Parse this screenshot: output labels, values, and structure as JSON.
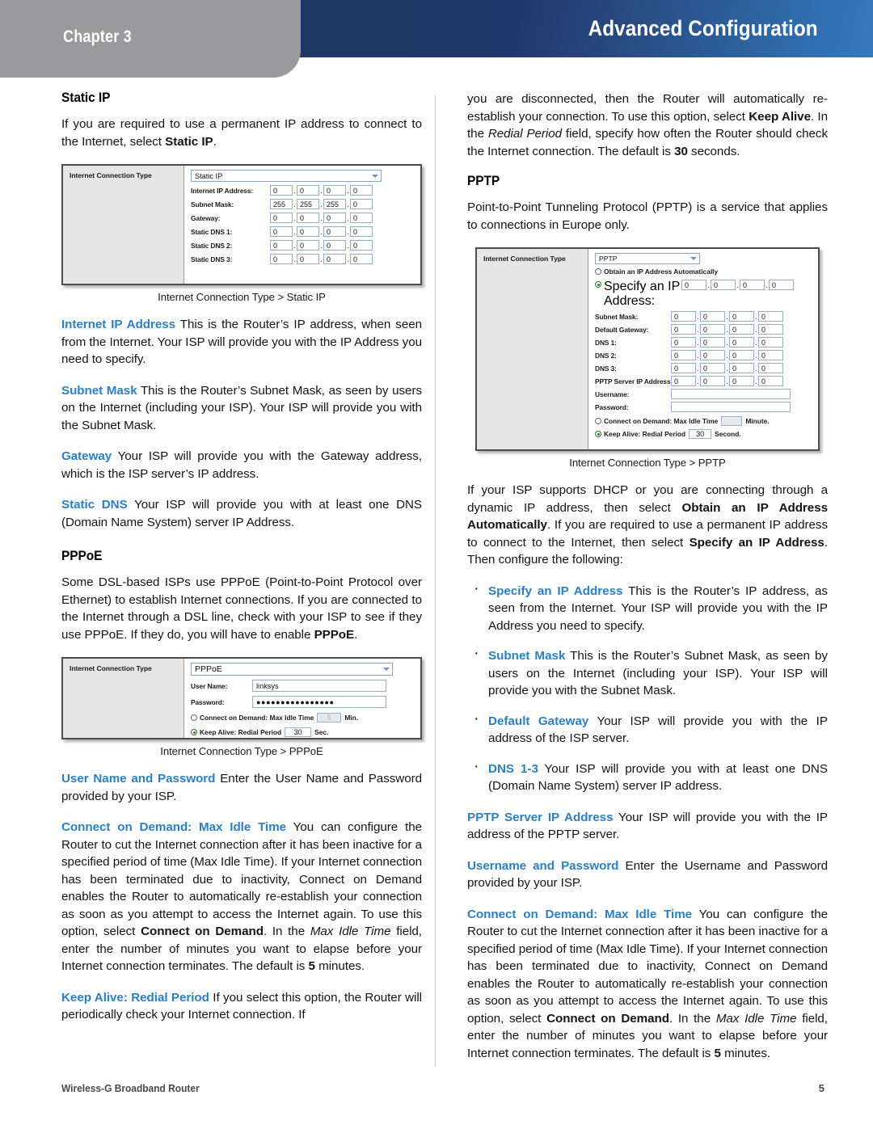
{
  "header": {
    "chapter": "Chapter 3",
    "title": "Advanced Configuration"
  },
  "footer": {
    "product": "Wireless-G Broadband Router",
    "page_number": "5"
  },
  "left_column": {
    "static_ip_heading": "Static IP",
    "static_ip_intro_a": "If you are required to use a permanent IP address to connect to the Internet, select ",
    "static_ip_intro_b": "Static IP",
    "static_ip_intro_c": ".",
    "figure_static_ip": {
      "panel_label": "Internet Connection Type",
      "select_value": "Static IP",
      "caption": "Internet Connection Type > Static IP",
      "rows": [
        {
          "label": "Internet IP Address:",
          "octets": [
            "0",
            "0",
            "0",
            "0"
          ]
        },
        {
          "label": "Subnet Mask:",
          "octets": [
            "255",
            "255",
            "255",
            "0"
          ]
        },
        {
          "label": "Gateway:",
          "octets": [
            "0",
            "0",
            "0",
            "0"
          ]
        },
        {
          "label": "Static DNS 1:",
          "octets": [
            "0",
            "0",
            "0",
            "0"
          ]
        },
        {
          "label": "Static DNS 2:",
          "octets": [
            "0",
            "0",
            "0",
            "0"
          ]
        },
        {
          "label": "Static DNS 3:",
          "octets": [
            "0",
            "0",
            "0",
            "0"
          ]
        }
      ]
    },
    "para_internet_ip_term": "Internet IP Address",
    "para_internet_ip_text": "  This is the Router’s IP address, when seen from the Internet. Your ISP will provide you with the IP Address you need to specify.",
    "para_subnet_term": "Subnet Mask",
    "para_subnet_text": "  This is the Router’s Subnet Mask, as seen by users on the Internet (including your ISP). Your ISP will provide you with the Subnet Mask.",
    "para_gateway_term": "Gateway",
    "para_gateway_text": "  Your ISP will provide you with the Gateway address, which is the ISP server’s IP address.",
    "para_staticdns_term": "Static DNS",
    "para_staticdns_text": "  Your ISP will provide you with at least one DNS (Domain Name System) server IP Address.",
    "pppoe_heading": "PPPoE",
    "pppoe_intro_a": "Some DSL-based ISPs use PPPoE (Point-to-Point Protocol over Ethernet) to establish Internet connections. If you are connected to the Internet through a DSL line, check with your ISP to see if they use PPPoE. If they do, you will have to enable ",
    "pppoe_intro_b": "PPPoE",
    "pppoe_intro_c": ".",
    "figure_pppoe": {
      "panel_label": "Internet Connection Type",
      "select_value": "PPPoE",
      "caption": "Internet Connection Type > PPPoE",
      "user_name_label": "User Name:",
      "user_name_value": "linksys",
      "password_label": "Password:",
      "password_value": "●●●●●●●●●●●●●●●●",
      "connect_on_demand_label": "Connect on Demand: Max Idle Time",
      "connect_on_demand_value": "5",
      "connect_on_demand_unit": "Min.",
      "keep_alive_label": "Keep Alive: Redial Period",
      "keep_alive_value": "30",
      "keep_alive_unit": "Sec."
    },
    "para_username_term": "User Name and Password",
    "para_username_text": " Enter the User Name and Password provided by your ISP.",
    "para_cod_term": "Connect on Demand: Max Idle Time",
    "para_cod_text_1": "  You can configure the Router to cut the Internet connection after it has been inactive for a specified period of time (Max Idle Time). If your Internet connection has been terminated due to inactivity, Connect on Demand enables the Router to automatically re-establish your connection as soon as you attempt to access the Internet again. To use this option, select ",
    "para_cod_bold_1": "Connect on Demand",
    "para_cod_text_2": ". In the ",
    "para_cod_italic": "Max Idle Time",
    "para_cod_text_3": " field, enter the number of minutes you want to elapse before your Internet connection terminates. The default is ",
    "para_cod_bold_2": "5",
    "para_cod_text_4": " minutes.",
    "para_keepalive_term": "Keep Alive: Redial Period",
    "para_keepalive_text": "  If you select this option, the Router will periodically check your Internet connection. If"
  },
  "right_column": {
    "cont_text_1": "you are disconnected, then the Router will automatically re-establish your connection. To use this option, select ",
    "cont_bold_1": "Keep Alive",
    "cont_text_2": ". In the ",
    "cont_italic": "Redial Period",
    "cont_text_3": " field, specify how often the Router should check the Internet connection. The default is ",
    "cont_bold_2": "30",
    "cont_text_4": " seconds.",
    "pptp_heading": "PPTP",
    "pptp_intro": "Point-to-Point Tunneling Protocol (PPTP) is a service that applies to connections in Europe only.",
    "figure_pptp": {
      "panel_label": "Internet Connection Type",
      "select_value": "PPTP",
      "caption": "Internet Connection Type > PPTP",
      "obtain_label": "Obtain an IP Address Automatically",
      "specify_label_line1": "Specify an IP",
      "specify_label_line2": "Address:",
      "specify_octets": [
        "0",
        "0",
        "0",
        "0"
      ],
      "rows": [
        {
          "label": "Subnet Mask:",
          "octets": [
            "0",
            "0",
            "0",
            "0"
          ]
        },
        {
          "label": "Default Gateway:",
          "octets": [
            "0",
            "0",
            "0",
            "0"
          ]
        },
        {
          "label": "DNS 1:",
          "octets": [
            "0",
            "0",
            "0",
            "0"
          ]
        },
        {
          "label": "DNS 2:",
          "octets": [
            "0",
            "0",
            "0",
            "0"
          ]
        },
        {
          "label": "DNS 3:",
          "octets": [
            "0",
            "0",
            "0",
            "0"
          ]
        },
        {
          "label": "PPTP Server IP Address:",
          "octets": [
            "0",
            "0",
            "0",
            "0"
          ]
        }
      ],
      "username_label": "Username:",
      "username_value": "",
      "password_label": "Password:",
      "password_value": "",
      "connect_on_demand_label": "Connect on Demand: Max Idle Time",
      "connect_on_demand_value": "",
      "connect_on_demand_unit": "Minute.",
      "keep_alive_label": "Keep Alive: Redial Period",
      "keep_alive_value": "30",
      "keep_alive_unit": "Second."
    },
    "dhcp_text_1": "If your ISP supports DHCP or you are connecting through a dynamic IP address, then select ",
    "dhcp_bold_1": "Obtain an IP Address Automatically",
    "dhcp_text_2": ". If you are required to use a permanent IP address to connect to the Internet, then select ",
    "dhcp_bold_2": "Specify an IP Address",
    "dhcp_text_3": ". Then configure the following:",
    "bullets": [
      {
        "term": "Specify an IP Address",
        "text": "  This is the Router’s IP address, as seen from the Internet. Your ISP will provide you with the IP Address you need to specify."
      },
      {
        "term": "Subnet Mask",
        "text": " This is the Router’s Subnet Mask, as seen by users on the Internet (including your ISP). Your ISP will provide you with the Subnet Mask."
      },
      {
        "term": "Default Gateway",
        "text": "  Your ISP will provide you with the IP address of the ISP server."
      },
      {
        "term": "DNS 1-3",
        "text": "  Your ISP will provide you with at least one DNS (Domain Name System) server IP address."
      }
    ],
    "para_pptpserver_term": "PPTP Server IP Address",
    "para_pptpserver_text": "  Your ISP will provide you with the IP address of the PPTP server.",
    "para_username_term": "Username and Password",
    "para_username_text": " Enter the Username and Password provided by your ISP.",
    "para_cod_term": "Connect on Demand: Max Idle Time",
    "para_cod_text_1": "  You can configure the Router to cut the Internet connection after it has been inactive for a specified period of time (Max Idle Time). If your Internet connection has been terminated due to inactivity, Connect on Demand enables the Router to automatically re-establish your connection as soon as you attempt to access the Internet again. To use this option, select ",
    "para_cod_bold_1": "Connect on Demand",
    "para_cod_text_2": ". In the ",
    "para_cod_italic": "Max Idle Time",
    "para_cod_text_3": " field, enter the number of minutes you want to elapse before your Internet connection terminates. The default is ",
    "para_cod_bold_2": "5",
    "para_cod_text_4": " minutes."
  }
}
